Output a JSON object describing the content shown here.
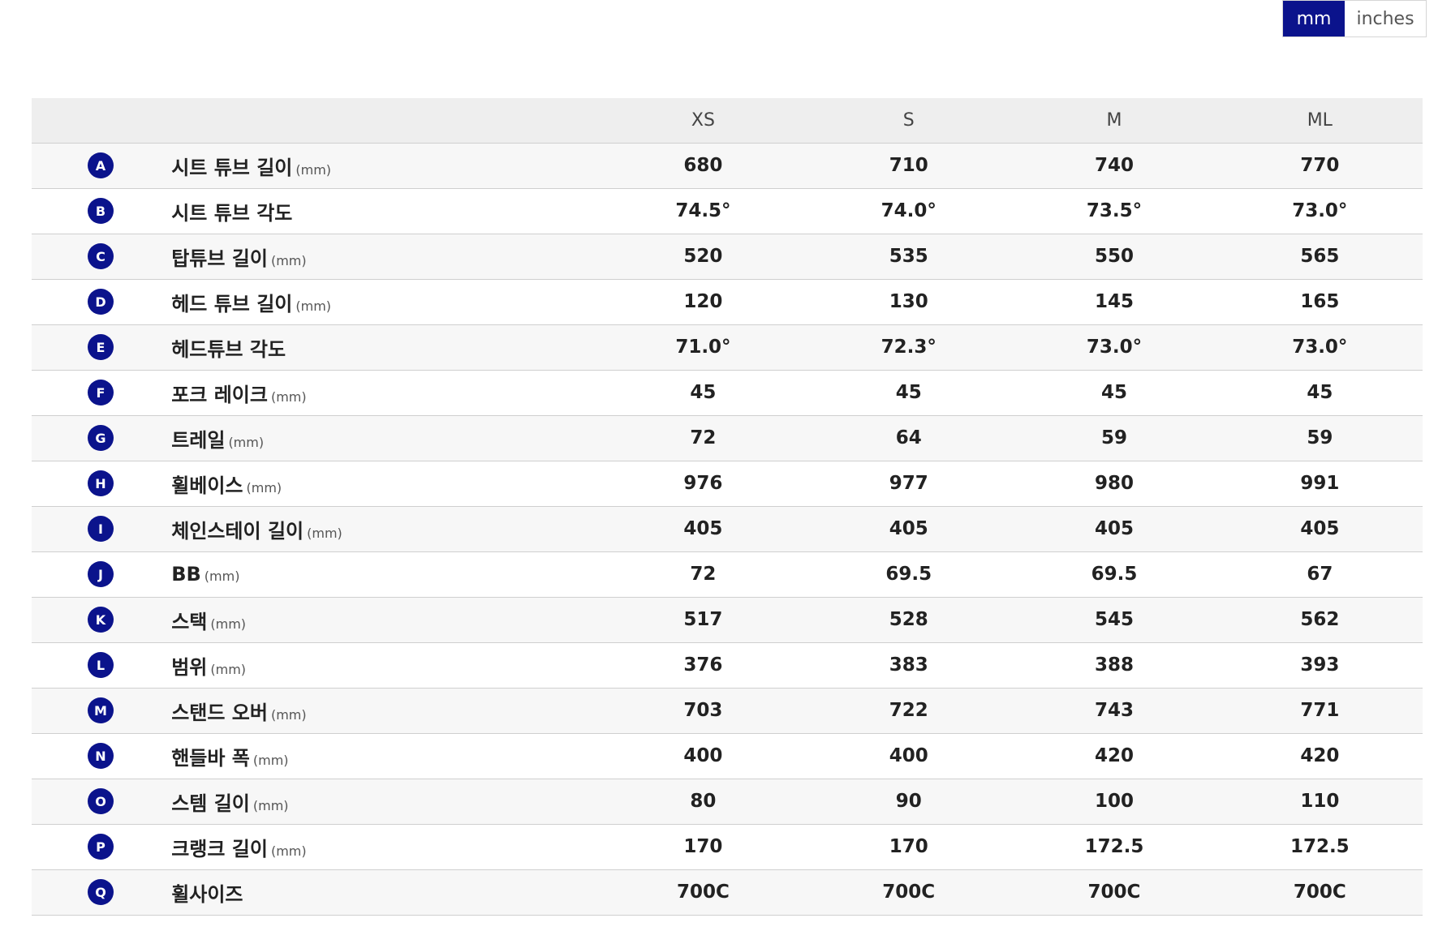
{
  "unit_toggle": {
    "options": [
      {
        "label": "mm",
        "active": true
      },
      {
        "label": "inches",
        "active": false
      }
    ],
    "active_color": "#0b138c"
  },
  "table": {
    "headers": [
      "",
      "",
      "XS",
      "S",
      "M",
      "ML"
    ],
    "rows": [
      {
        "letter": "A",
        "label": "시트 튜브 길이",
        "unit": "(mm)",
        "values": [
          "680",
          "710",
          "740",
          "770"
        ]
      },
      {
        "letter": "B",
        "label": "시트 튜브 각도",
        "unit": "",
        "values": [
          "74.5°",
          "74.0°",
          "73.5°",
          "73.0°"
        ]
      },
      {
        "letter": "C",
        "label": "탑튜브 길이",
        "unit": "(mm)",
        "values": [
          "520",
          "535",
          "550",
          "565"
        ]
      },
      {
        "letter": "D",
        "label": "헤드 튜브 길이",
        "unit": "(mm)",
        "values": [
          "120",
          "130",
          "145",
          "165"
        ]
      },
      {
        "letter": "E",
        "label": "헤드튜브 각도",
        "unit": "",
        "values": [
          "71.0°",
          "72.3°",
          "73.0°",
          "73.0°"
        ]
      },
      {
        "letter": "F",
        "label": "포크 레이크",
        "unit": "(mm)",
        "values": [
          "45",
          "45",
          "45",
          "45"
        ]
      },
      {
        "letter": "G",
        "label": "트레일",
        "unit": "(mm)",
        "values": [
          "72",
          "64",
          "59",
          "59"
        ]
      },
      {
        "letter": "H",
        "label": "휠베이스",
        "unit": "(mm)",
        "values": [
          "976",
          "977",
          "980",
          "991"
        ]
      },
      {
        "letter": "I",
        "label": "체인스테이 길이",
        "unit": "(mm)",
        "values": [
          "405",
          "405",
          "405",
          "405"
        ]
      },
      {
        "letter": "J",
        "label": "BB",
        "unit": "(mm)",
        "values": [
          "72",
          "69.5",
          "69.5",
          "67"
        ]
      },
      {
        "letter": "K",
        "label": "스택",
        "unit": "(mm)",
        "values": [
          "517",
          "528",
          "545",
          "562"
        ]
      },
      {
        "letter": "L",
        "label": "범위",
        "unit": "(mm)",
        "values": [
          "376",
          "383",
          "388",
          "393"
        ]
      },
      {
        "letter": "M",
        "label": "스탠드 오버",
        "unit": "(mm)",
        "values": [
          "703",
          "722",
          "743",
          "771"
        ]
      },
      {
        "letter": "N",
        "label": "핸들바 폭",
        "unit": "(mm)",
        "values": [
          "400",
          "400",
          "420",
          "420"
        ]
      },
      {
        "letter": "O",
        "label": "스템 길이",
        "unit": "(mm)",
        "values": [
          "80",
          "90",
          "100",
          "110"
        ]
      },
      {
        "letter": "P",
        "label": "크랭크 길이",
        "unit": "(mm)",
        "values": [
          "170",
          "170",
          "172.5",
          "172.5"
        ]
      },
      {
        "letter": "Q",
        "label": "휠사이즈",
        "unit": "",
        "values": [
          "700C",
          "700C",
          "700C",
          "700C"
        ]
      }
    ]
  }
}
